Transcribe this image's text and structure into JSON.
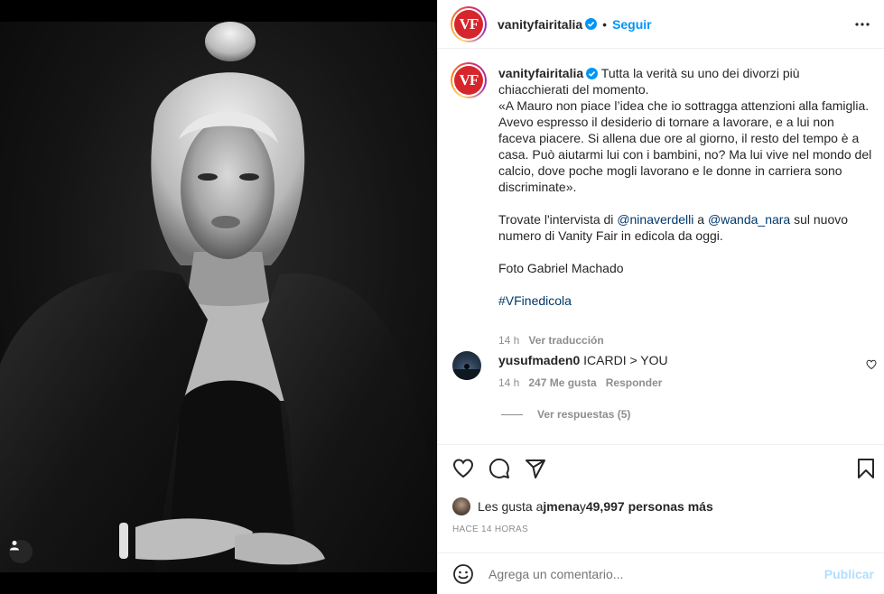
{
  "post": {
    "account": "vanityfairitalia",
    "logo_text": "VF",
    "follow_label": "Seguir",
    "separator": "•",
    "caption": {
      "intro": " Tutta la verità su uno dei divorzi più chiacchierati del momento.\n«A Mauro non piace l’idea che io sottragga attenzioni alla famiglia. Avevo espresso il desiderio di tornare a lavorare, e a lui non faceva piacere. Si allena due ore al giorno, il resto del tempo è a casa. Può aiutarmi lui con i bambini, no? Ma lui vive nel mondo del calcio, dove poche mogli lavorano e le donne in carriera sono discriminate».\n\nTrovate l'intervista di ",
      "mention1": "@ninaverdelli",
      "mid": " a ",
      "mention2": "@wanda_nara",
      "rest": " sul nuovo numero di Vanity Fair in edicola da oggi.\n\nFoto Gabriel Machado\n\n",
      "hashtag": "#VFinedicola"
    },
    "caption_time": "14 h",
    "see_translation": "Ver traducción"
  },
  "comment": {
    "user": "yusufmaden0",
    "text": "ICARDI > YOU",
    "time": "14 h",
    "likes": "247 Me gusta",
    "reply": "Responder",
    "view_replies": "Ver respuestas (5)"
  },
  "likes": {
    "prefix": "Les gusta a ",
    "user": "jmena",
    "connector": " y ",
    "count": "49,997 personas más"
  },
  "timestamp": "HACE 14 HORAS",
  "add_comment": {
    "placeholder": "Agrega un comentario...",
    "publish_label": "Publicar"
  },
  "colors": {
    "link": "#0095f6",
    "mention": "#00376b",
    "brand": "#d7262b"
  },
  "icons": [
    "verified-badge-icon",
    "more-options-icon",
    "heart-icon",
    "comment-icon",
    "share-icon",
    "bookmark-icon",
    "emoji-icon",
    "user-tag-icon"
  ]
}
